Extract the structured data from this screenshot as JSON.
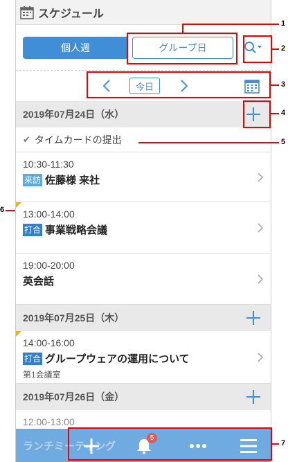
{
  "app": {
    "title": "スケジュール"
  },
  "tabs": {
    "personal_week": "個人週",
    "group_day": "グループ日"
  },
  "nav": {
    "today": "今日"
  },
  "days": [
    {
      "date": "2019年07月24日（水）"
    },
    {
      "date": "2019年07月25日（木）"
    },
    {
      "date": "2019年07月26日（金）"
    }
  ],
  "timecard": {
    "label": "タイムカードの提出"
  },
  "events": [
    {
      "time": "10:30-11:30",
      "badge": "来訪",
      "badge_color": "#5ba9e0",
      "title": "佐藤様 来社"
    },
    {
      "time": "13:00-14:00",
      "badge": "打合",
      "badge_color": "#2f7fd0",
      "title": "事業戦略会議"
    },
    {
      "time": "19:00-20:00",
      "badge": "",
      "title": "英会話"
    },
    {
      "time": "14:00-16:00",
      "badge": "打合",
      "badge_color": "#2f7fd0",
      "title": "グループウェアの運用について",
      "sub": "第1会議室"
    },
    {
      "time": "12:00-13:00",
      "title": "ランチミーティング"
    }
  ],
  "bottom": {
    "notification_count": "5"
  },
  "callouts": [
    "1",
    "2",
    "3",
    "4",
    "5",
    "6",
    "7"
  ],
  "colors": {
    "accent": "#3f8ed6",
    "callout": "#e00000",
    "flag": "#f0b400"
  }
}
